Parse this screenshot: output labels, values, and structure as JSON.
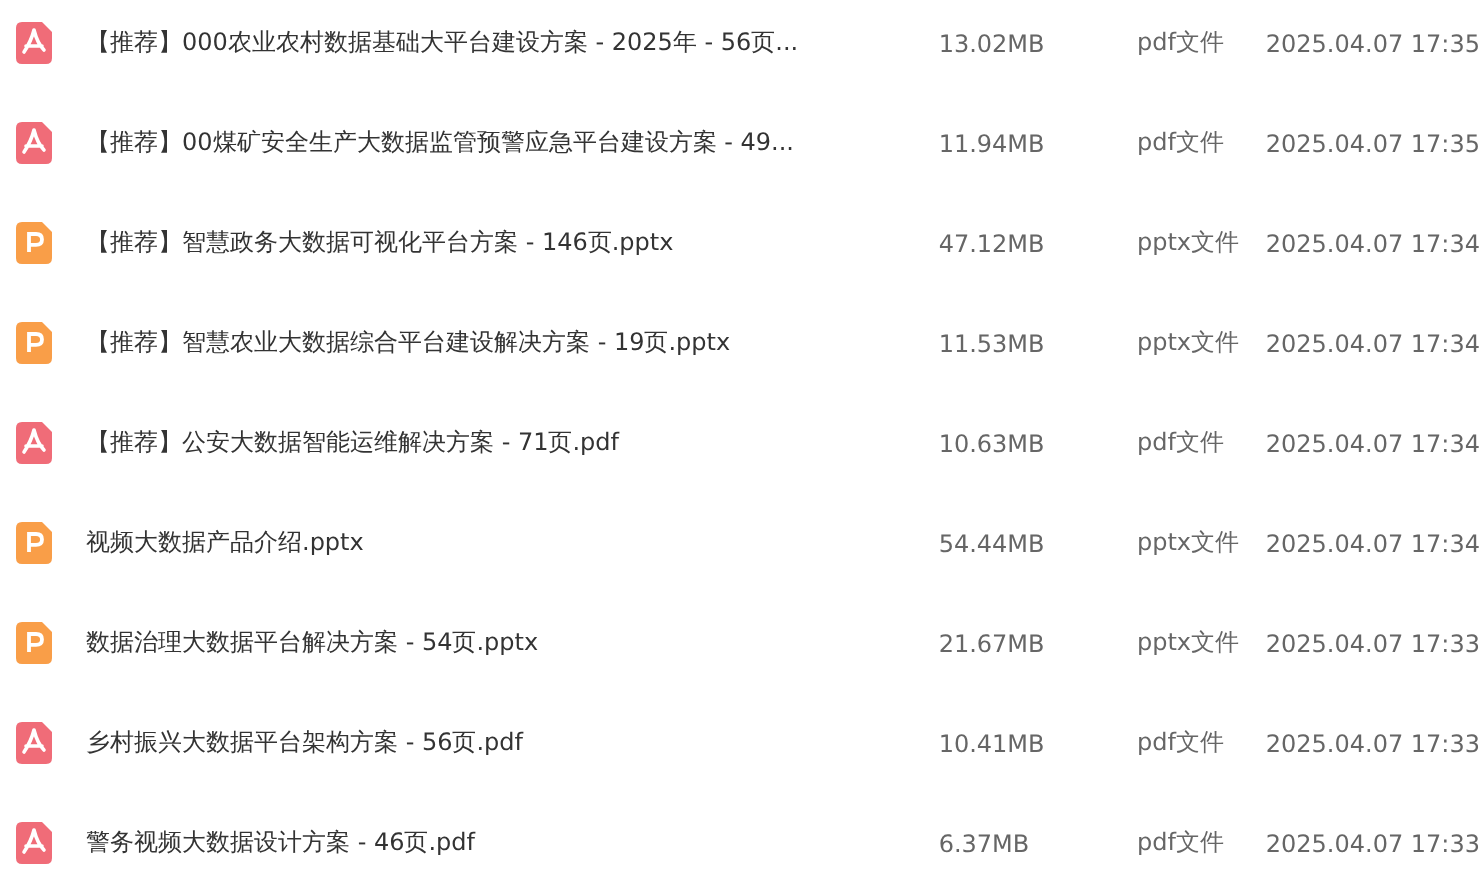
{
  "files": [
    {
      "kind": "pdf",
      "name": "【推荐】000农业农村数据基础大平台建设方案 - 2025年 - 56页...",
      "size": "13.02MB",
      "type": "pdf文件",
      "modified": "2025.04.07 17:35"
    },
    {
      "kind": "pdf",
      "name": "【推荐】00煤矿安全生产大数据监管预警应急平台建设方案 - 49...",
      "size": "11.94MB",
      "type": "pdf文件",
      "modified": "2025.04.07 17:35"
    },
    {
      "kind": "pptx",
      "name": "【推荐】智慧政务大数据可视化平台方案 - 146页.pptx",
      "size": "47.12MB",
      "type": "pptx文件",
      "modified": "2025.04.07 17:34"
    },
    {
      "kind": "pptx",
      "name": "【推荐】智慧农业大数据综合平台建设解决方案 - 19页.pptx",
      "size": "11.53MB",
      "type": "pptx文件",
      "modified": "2025.04.07 17:34"
    },
    {
      "kind": "pdf",
      "name": "【推荐】公安大数据智能运维解决方案 - 71页.pdf",
      "size": "10.63MB",
      "type": "pdf文件",
      "modified": "2025.04.07 17:34"
    },
    {
      "kind": "pptx",
      "name": "视频大数据产品介绍.pptx",
      "size": "54.44MB",
      "type": "pptx文件",
      "modified": "2025.04.07 17:34"
    },
    {
      "kind": "pptx",
      "name": "数据治理大数据平台解决方案 - 54页.pptx",
      "size": "21.67MB",
      "type": "pptx文件",
      "modified": "2025.04.07 17:33"
    },
    {
      "kind": "pdf",
      "name": "乡村振兴大数据平台架构方案 - 56页.pdf",
      "size": "10.41MB",
      "type": "pdf文件",
      "modified": "2025.04.07 17:33"
    },
    {
      "kind": "pdf",
      "name": "警务视频大数据设计方案 - 46页.pdf",
      "size": "6.37MB",
      "type": "pdf文件",
      "modified": "2025.04.07 17:33"
    }
  ]
}
